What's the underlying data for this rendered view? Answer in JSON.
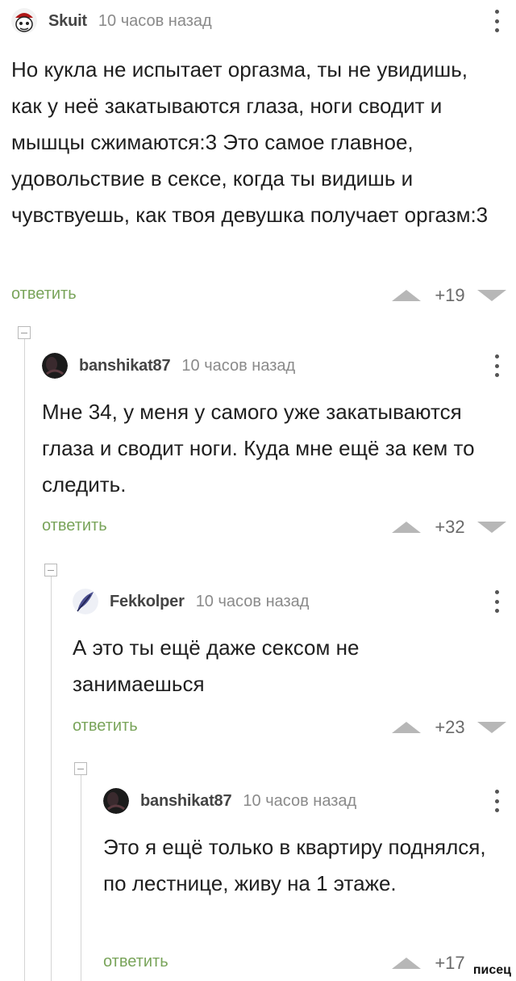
{
  "colors": {
    "reply_link": "#79a45a",
    "vote_arrow": "#b7b7b7",
    "time": "#8a8a8a",
    "thread_line": "#d4d4d4"
  },
  "comments": [
    {
      "author": "Skuit",
      "time": "10 часов назад",
      "text": "Но кукла не испытает оргазма, ты не увидишь, как у неё закатываются глаза, ноги сводит и мышцы сжимаются:3 Это самое главное, удовольствие в сексе, когда ты видишь и чувствуешь, как твоя девушка получает оргазм:3",
      "reply": "ответить",
      "score": "+19",
      "avatar_icon": "avatar-cartoon-icon"
    },
    {
      "author": "banshikat87",
      "time": "10 часов назад",
      "text": "Мне 34, у меня у самого уже закатываются глаза и сводит ноги. Куда мне ещё за кем то следить.",
      "reply": "ответить",
      "score": "+32",
      "avatar_icon": "avatar-dark-icon"
    },
    {
      "author": "Fekkolper",
      "time": "10 часов назад",
      "text": "А это ты ещё даже сексом не занимаешься",
      "reply": "ответить",
      "score": "+23",
      "avatar_icon": "avatar-feather-icon"
    },
    {
      "author": "banshikat87",
      "time": "10 часов назад",
      "text": "Это я ещё только в квартиру поднялся, по лестнице, живу на 1 этаже.",
      "reply": "ответить",
      "score": "+17",
      "avatar_icon": "avatar-dark-icon"
    }
  ],
  "watermark": "писец"
}
